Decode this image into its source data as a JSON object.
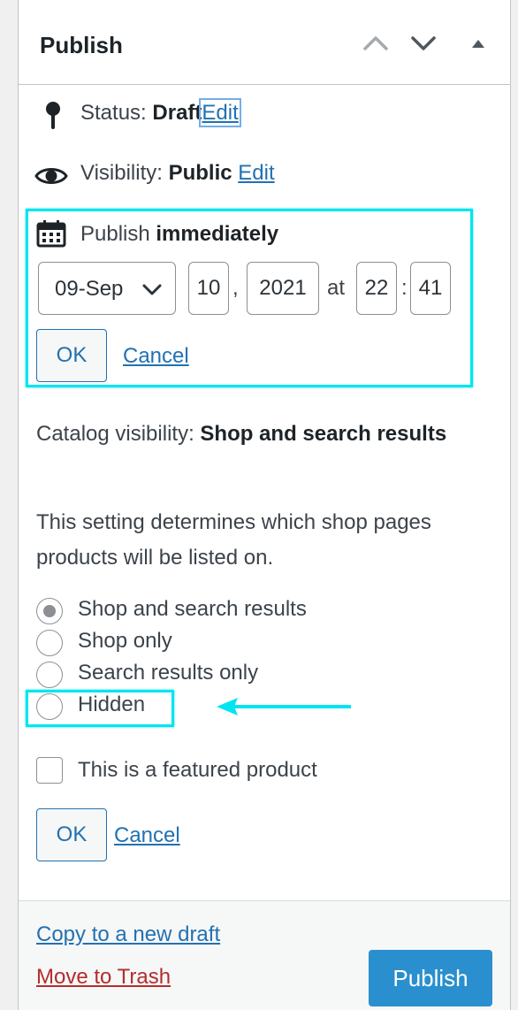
{
  "header": {
    "title": "Publish",
    "move_up_icon": "chevron-up-icon",
    "move_down_icon": "chevron-down-icon",
    "toggle_icon": "triangle-up-icon"
  },
  "status": {
    "label": "Status:",
    "value": "Draft",
    "edit": "Edit",
    "icon": "pin-icon"
  },
  "visibility": {
    "label": "Visibility:",
    "value": "Public",
    "edit": "Edit",
    "icon": "eye-icon"
  },
  "schedule": {
    "label": "Publish",
    "value": "immediately",
    "icon": "calendar-icon",
    "month": "09-Sep",
    "day": "10",
    "comma": ",",
    "year": "2021",
    "at": "at",
    "hour": "22",
    "colon": ":",
    "minute": "41",
    "ok": "OK",
    "cancel": "Cancel"
  },
  "catalog": {
    "label": "Catalog visibility:",
    "value": "Shop and search results",
    "description": "This setting determines which shop pages products will be listed on.",
    "options": [
      {
        "label": "Shop and search results",
        "checked": true
      },
      {
        "label": "Shop only",
        "checked": false
      },
      {
        "label": "Search results only",
        "checked": false
      },
      {
        "label": "Hidden",
        "checked": false
      }
    ],
    "featured_label": "This is a featured product",
    "ok": "OK",
    "cancel": "Cancel"
  },
  "footer": {
    "copy_draft": "Copy to a new draft",
    "trash": "Move to Trash",
    "publish": "Publish"
  },
  "colors": {
    "highlight": "#00e5ef",
    "link": "#2271b1",
    "trash": "#b32d2e",
    "primary": "#2a8fce"
  }
}
